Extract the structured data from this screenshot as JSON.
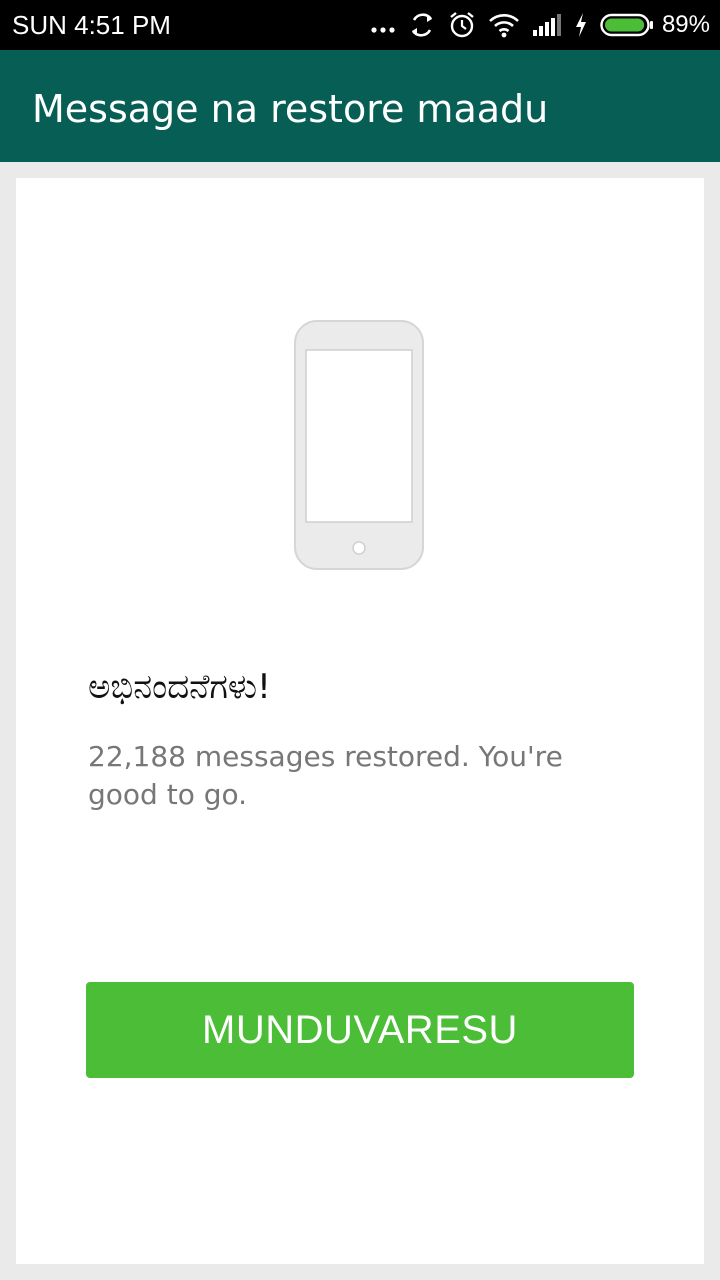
{
  "status_bar": {
    "time": "SUN 4:51 PM",
    "battery_percent": "89%",
    "icons": [
      "more-dots-icon",
      "sync-icon",
      "alarm-icon",
      "wifi-icon",
      "signal-icon",
      "charging-icon",
      "battery-icon"
    ],
    "battery_level": 0.89,
    "battery_color": "#4cbd37"
  },
  "app_bar": {
    "title": "Message na restore maadu",
    "background_color": "#075e54"
  },
  "main": {
    "illustration_icon": "phone-icon",
    "headline": "ಅಭಿನಂದನೆಗಳು!",
    "body": "22,188 messages restored. You're good to go.",
    "continue_label": "MUNDUVARESU",
    "button_color": "#4cbd37"
  }
}
